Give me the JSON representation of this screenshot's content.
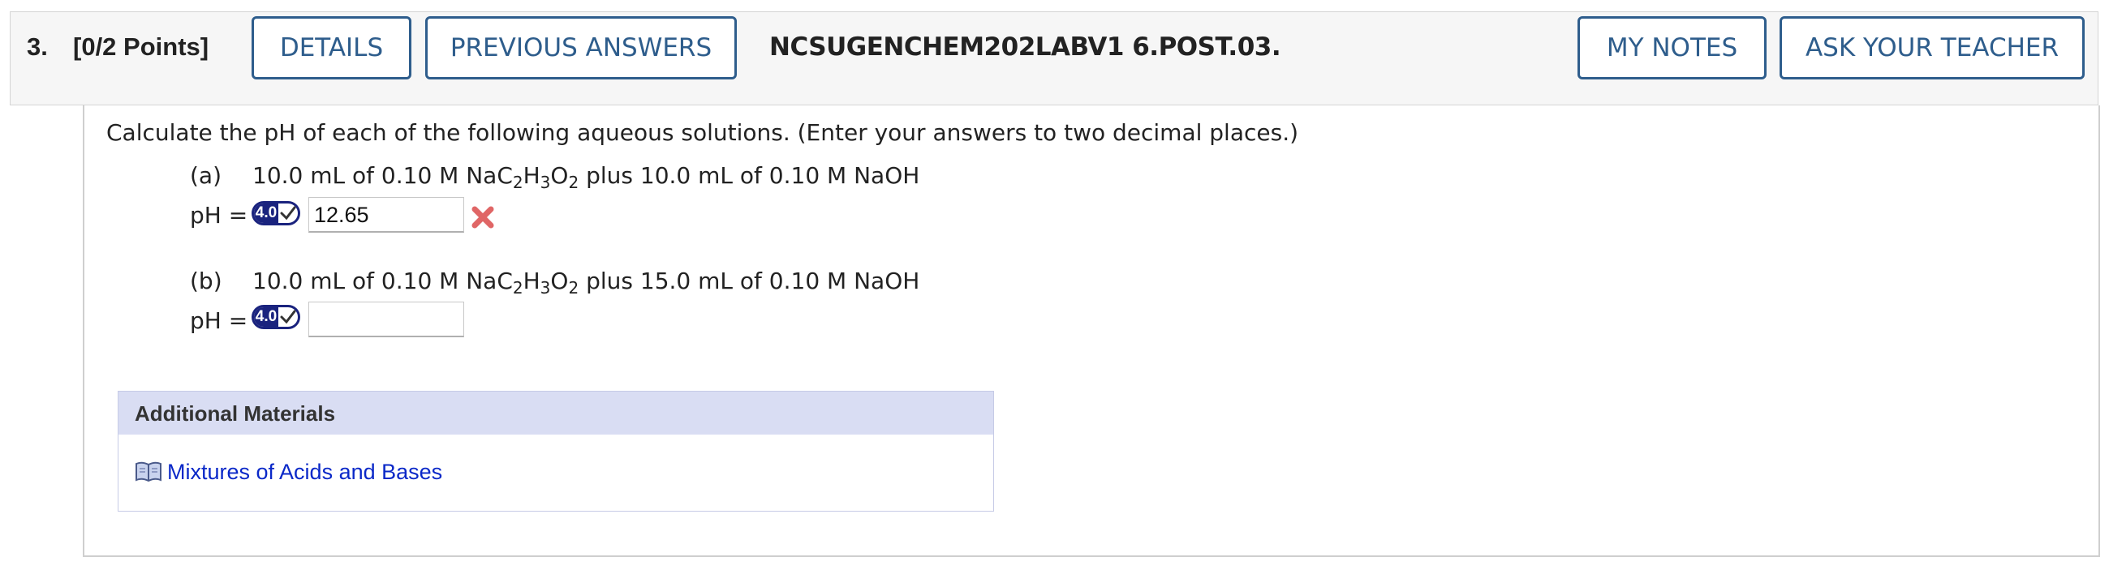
{
  "header": {
    "question_number": "3.",
    "points": "[0/2 Points]",
    "details_label": "DETAILS",
    "previous_answers_label": "PREVIOUS ANSWERS",
    "question_code": "NCSUGENCHEM202LABV1 6.POST.03.",
    "my_notes_label": "MY NOTES",
    "ask_teacher_label": "ASK YOUR TEACHER"
  },
  "question": {
    "prompt": "Calculate the pH of each of the following aqueous solutions. (Enter your answers to two decimal places.)",
    "parts": [
      {
        "label": "(a)",
        "text_before": "10.0 mL of 0.10 M NaC",
        "sub1": "2",
        "mid1": "H",
        "sub2": "3",
        "mid2": "O",
        "sub3": "2",
        "text_after": " plus 10.0 mL of 0.10 M NaOH",
        "ph_label": "pH =",
        "badge_number": "4.0",
        "answer_value": "12.65",
        "status": "incorrect"
      },
      {
        "label": "(b)",
        "text_before": "10.0 mL of 0.10 M NaC",
        "sub1": "2",
        "mid1": "H",
        "sub2": "3",
        "mid2": "O",
        "sub3": "2",
        "text_after": " plus 15.0 mL of 0.10 M NaOH",
        "ph_label": "pH =",
        "badge_number": "4.0",
        "answer_value": ""
      }
    ]
  },
  "additional_materials": {
    "title": "Additional Materials",
    "link_label": "Mixtures of Acids and Bases"
  },
  "colors": {
    "button_border": "#2e5d8c",
    "badge_navy": "#1a237e",
    "incorrect_red": "#e06666",
    "link_blue": "#0a28c8",
    "panel_header": "#d9ddf3"
  },
  "icons": {
    "badge_check": "check-icon",
    "incorrect": "x-mark-icon",
    "material": "book-icon"
  }
}
